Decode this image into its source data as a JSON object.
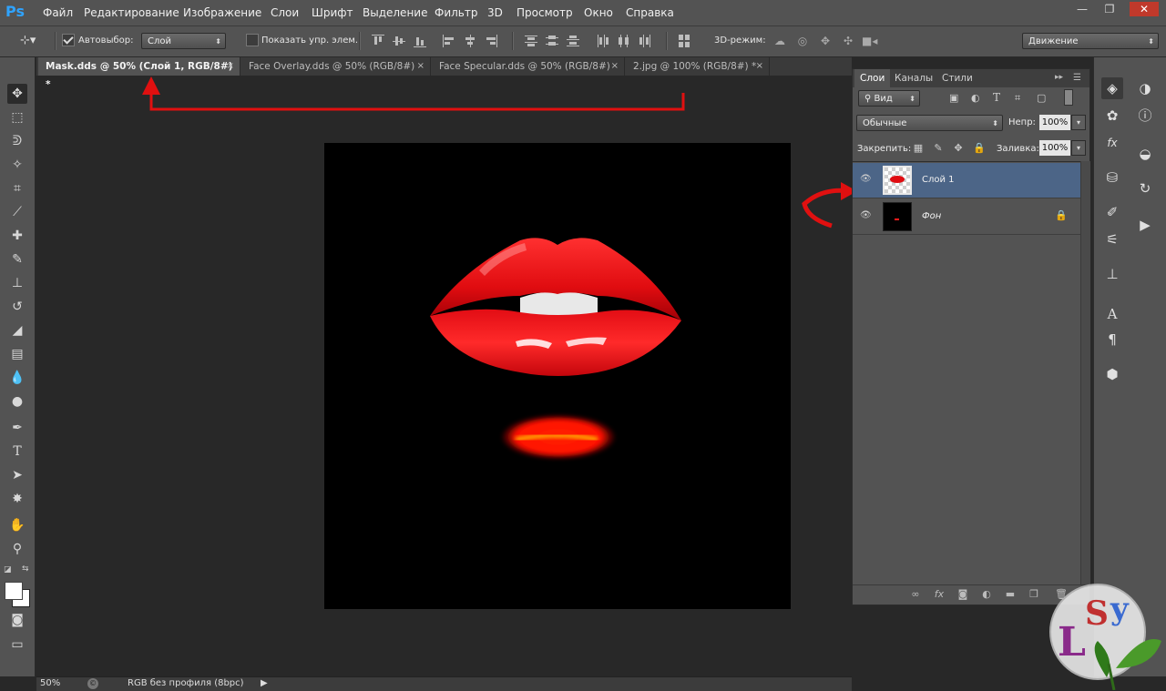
{
  "app": {
    "logo": "Ps"
  },
  "menu": [
    "Файл",
    "Редактирование",
    "Изображение",
    "Слои",
    "Шрифт",
    "Выделение",
    "Фильтр",
    "3D",
    "Просмотр",
    "Окно",
    "Справка"
  ],
  "window_controls": {
    "minimize": "—",
    "restore": "❐",
    "close": "✕"
  },
  "options": {
    "autoselect_label": "Автовыбор:",
    "autoselect_checked": true,
    "autoselect_value": "Слой",
    "show_controls_label": "Показать упр. элем.",
    "show_controls_checked": false,
    "mode_3d_label": "3D-режим:",
    "workspace": "Движение"
  },
  "tabs": [
    {
      "label": "Mask.dds @ 50% (Слой 1, RGB/8#) *",
      "active": true
    },
    {
      "label": "Face Overlay.dds @ 50% (RGB/8#)",
      "active": false
    },
    {
      "label": "Face Specular.dds @ 50% (RGB/8#)",
      "active": false
    },
    {
      "label": "2.jpg @ 100% (RGB/8#) *",
      "active": false
    }
  ],
  "tab_close_glyph": "×",
  "status": {
    "zoom": "50%",
    "profile": "RGB без профиля (8bpc)"
  },
  "layers_panel": {
    "tabs": [
      "Слои",
      "Каналы",
      "Стили"
    ],
    "filter_label": "Вид",
    "blend_mode": "Обычные",
    "opacity_label": "Непр:",
    "opacity_value": "100%",
    "lock_label": "Закрепить:",
    "fill_label": "Заливка:",
    "fill_value": "100%",
    "layers": [
      {
        "name": "Слой 1",
        "selected": true,
        "locked": false
      },
      {
        "name": "Фон",
        "selected": false,
        "locked": true
      }
    ]
  },
  "colors": {
    "accent_blue": "#2fa3ff",
    "annotation_red": "#e01010",
    "selected_layer": "#4c6587",
    "lip_red": "#ff1a1a"
  },
  "watermark": {
    "text": "LSy"
  }
}
